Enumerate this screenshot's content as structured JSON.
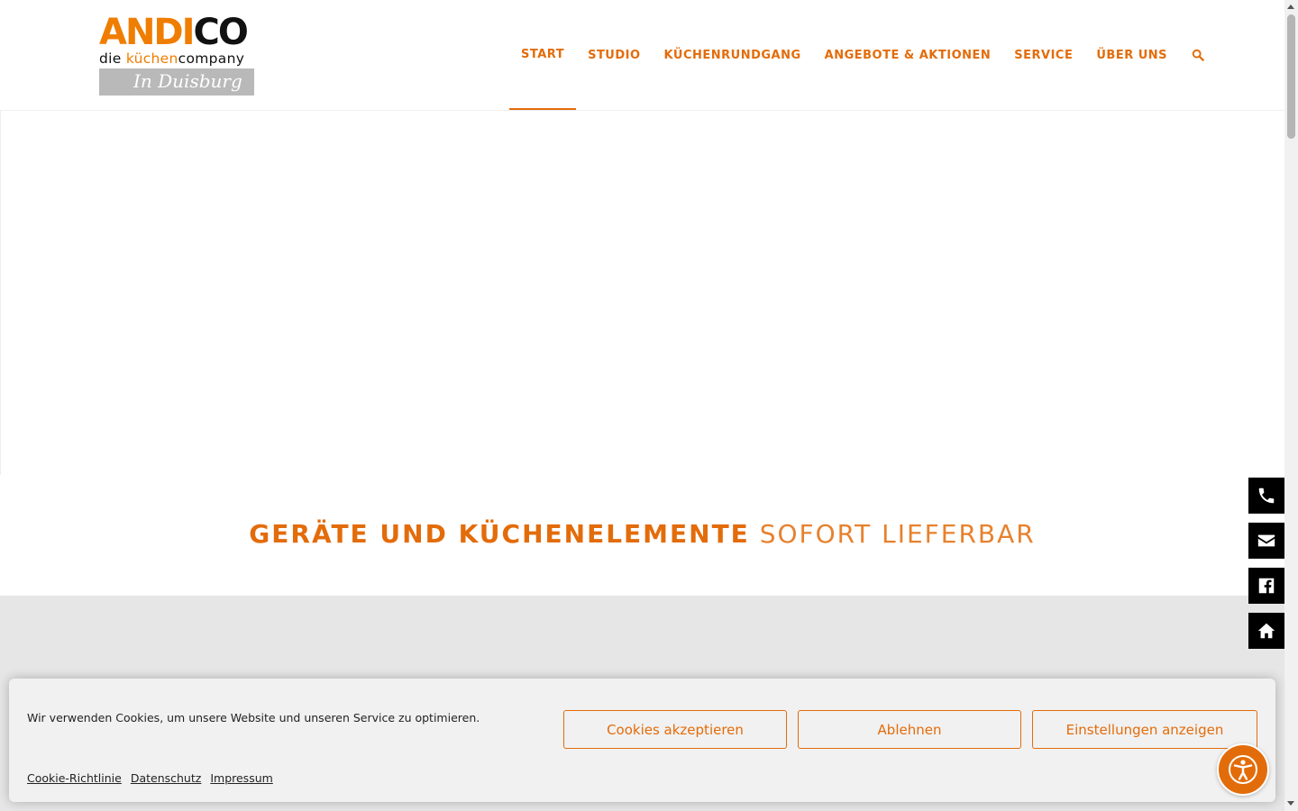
{
  "logo": {
    "top_orange": "ANDI",
    "top_black": "CO",
    "sub_prefix": "die ",
    "sub_orange": "küchen",
    "sub_suffix": "company",
    "band_text": "In Duisburg"
  },
  "nav": {
    "items": [
      {
        "label": "START",
        "active": true
      },
      {
        "label": "STUDIO"
      },
      {
        "label": "KÜCHENRUNDGANG"
      },
      {
        "label": "ANGEBOTE & AKTIONEN"
      },
      {
        "label": "SERVICE"
      },
      {
        "label": "ÜBER UNS"
      }
    ],
    "search_icon": "search-icon"
  },
  "headline": {
    "bold": "GERÄTE UND KÜCHENELEMENTE",
    "light": "SOFORT LIEFERBAR"
  },
  "side_icons": [
    "phone-icon",
    "envelope-icon",
    "facebook-icon",
    "home-icon"
  ],
  "cookie": {
    "text": "Wir verwenden Cookies, um unsere Website und unseren Service zu optimieren.",
    "accept": "Cookies akzeptieren",
    "decline": "Ablehnen",
    "settings": "Einstellungen anzeigen",
    "links": [
      "Cookie-Richtlinie",
      "Datenschutz",
      "Impressum"
    ]
  },
  "accessibility_icon": "accessibility-icon",
  "colors": {
    "accent": "#e36c0a",
    "logo_orange": "#ef7d00",
    "gray_section": "#e6e6e6",
    "cookie_bg": "#f1f1f1"
  }
}
